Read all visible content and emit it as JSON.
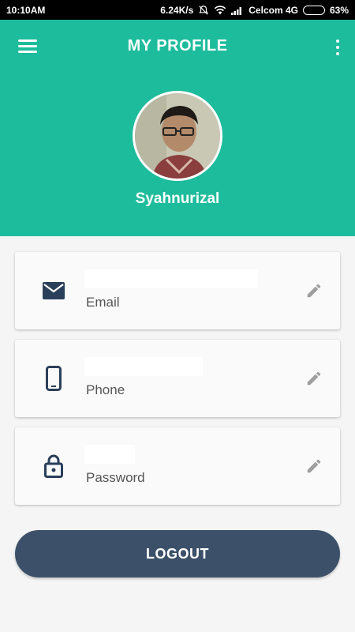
{
  "status_bar": {
    "time": "10:10AM",
    "speed": "6.24K/s",
    "carrier": "Celcom 4G",
    "battery_text": "63%",
    "battery_level": 0.63
  },
  "header": {
    "title": "MY PROFILE",
    "username": "Syahnurizal"
  },
  "fields": [
    {
      "label": "Email",
      "icon": "email-icon"
    },
    {
      "label": "Phone",
      "icon": "phone-icon"
    },
    {
      "label": "Password",
      "icon": "lock-icon"
    }
  ],
  "logout_label": "LOGOUT",
  "colors": {
    "header_bg": "#1dbc9c",
    "button_bg": "#3c5169",
    "icon_color": "#2a3f59"
  }
}
